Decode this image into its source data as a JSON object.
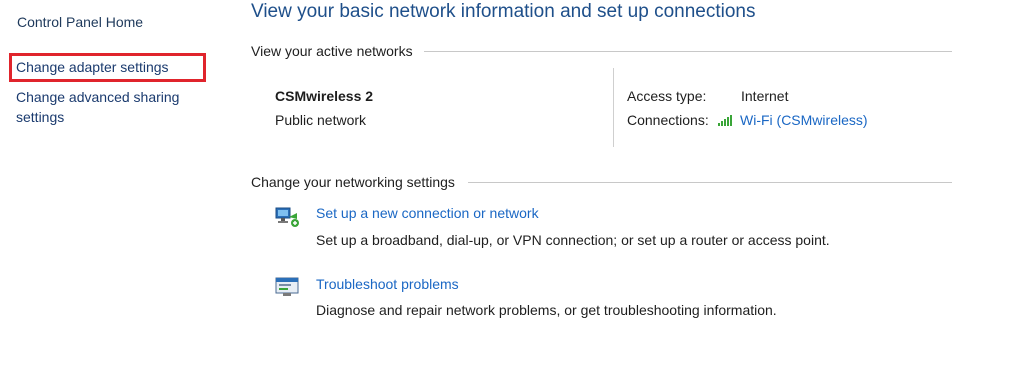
{
  "sidebar": {
    "home_label": "Control Panel Home",
    "adapter_label": "Change adapter settings",
    "sharing_label": "Change advanced sharing settings"
  },
  "main": {
    "title": "View your basic network information and set up connections",
    "active_networks_heading": "View your active networks",
    "network": {
      "name": "CSMwireless  2",
      "category": "Public network",
      "access_type_label": "Access type:",
      "access_type_value": "Internet",
      "connections_label": "Connections:",
      "connections_value": "Wi-Fi (CSMwireless)"
    },
    "change_settings_heading": "Change your networking settings",
    "tasks": [
      {
        "icon": "new-connection-icon",
        "link": "Set up a new connection or network",
        "description": "Set up a broadband, dial-up, or VPN connection; or set up a router or access point."
      },
      {
        "icon": "troubleshoot-icon",
        "link": "Troubleshoot problems",
        "description": "Diagnose and repair network problems, or get troubleshooting information."
      }
    ]
  },
  "colors": {
    "link": "#1a67c4",
    "title": "#1e4f8a",
    "highlight_box": "#e0242c",
    "signal": "#3aa538"
  }
}
